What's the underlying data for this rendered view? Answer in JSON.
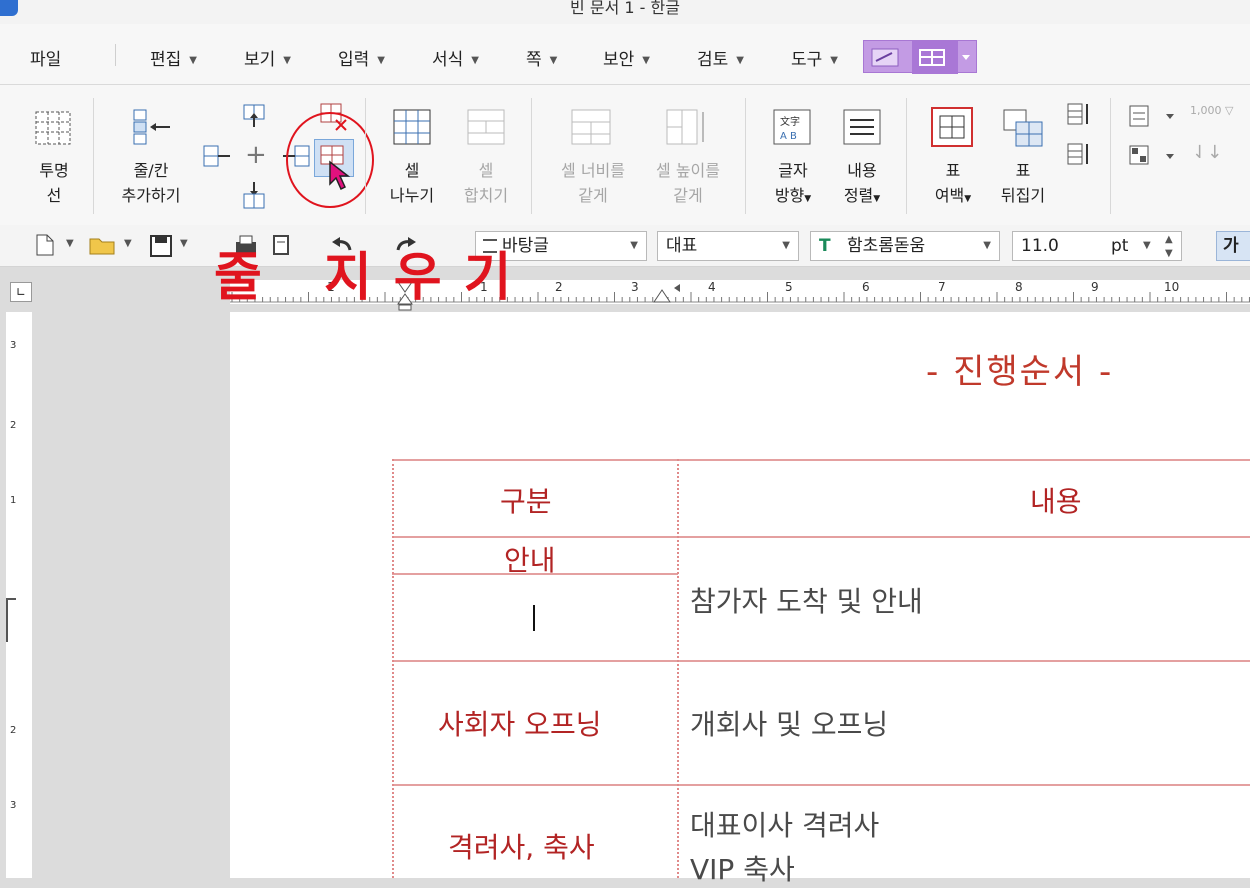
{
  "window": {
    "title": "빈 문서 1 - 한글"
  },
  "menu": {
    "items": [
      {
        "label": "파일"
      },
      {
        "label": "편집"
      },
      {
        "label": "보기"
      },
      {
        "label": "입력"
      },
      {
        "label": "서식"
      },
      {
        "label": "쪽"
      },
      {
        "label": "보안"
      },
      {
        "label": "검토"
      },
      {
        "label": "도구"
      }
    ]
  },
  "ribbon": {
    "transparent_line": {
      "line1": "투명",
      "line2": "선"
    },
    "add_row_col": {
      "line1": "줄/칸",
      "line2": "추가하기"
    },
    "split_cell": {
      "line1": "셀",
      "line2": "나누기"
    },
    "merge_cell": {
      "line1": "셀",
      "line2": "합치기"
    },
    "equal_width": {
      "line1": "셀 너비를",
      "line2": "같게"
    },
    "equal_height": {
      "line1": "셀 높이를",
      "line2": "같게"
    },
    "text_direction": {
      "line1": "글자",
      "line2": "방향"
    },
    "content_align": {
      "line1": "내용",
      "line2": "정렬"
    },
    "table_margin": {
      "line1": "표",
      "line2": "여백"
    },
    "table_flip": {
      "line1": "표",
      "line2": "뒤집기"
    }
  },
  "toolbar": {
    "style": "바탕글",
    "lang": "대표",
    "font": "함초롬돋움",
    "size": "11.0",
    "unit": "pt",
    "bold_char": "가"
  },
  "ruler": {
    "ticks": [
      "1",
      "1",
      "2",
      "3",
      "4",
      "5",
      "6",
      "7",
      "8",
      "9",
      "10"
    ]
  },
  "annotation": {
    "label": "줄 지우기"
  },
  "document": {
    "title": "- 진행순서 -",
    "table": {
      "headers": [
        "구분",
        "내용"
      ],
      "rows": [
        {
          "category": "안내",
          "content": "참가자 도착 및 안내"
        },
        {
          "category": "사회자 오프닝",
          "content": "개회사 및 오프닝"
        },
        {
          "category": "격려사, 축사",
          "content_line1": "대표이사 격려사",
          "content_line2": "VIP 축사"
        }
      ]
    }
  },
  "colors": {
    "accent": "#c39be4",
    "doc_red": "#b22424",
    "annotation_red": "#e0141e"
  }
}
